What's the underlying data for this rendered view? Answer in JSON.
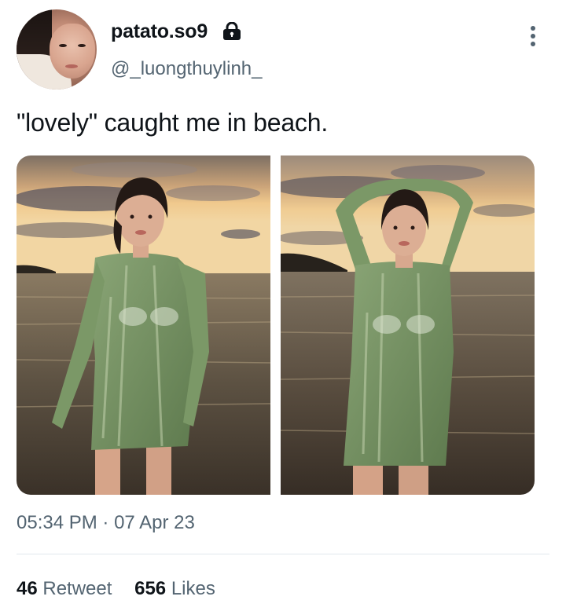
{
  "user": {
    "display_name": "patato.so9",
    "handle": "@_luongthuylinh_",
    "protected": true
  },
  "tweet": {
    "text": "\"lovely\" caught me in beach.",
    "time": "05:34 PM",
    "separator": "·",
    "date": "07 Apr 23"
  },
  "stats": {
    "retweets_count": "46",
    "retweets_label": "Retweet",
    "likes_count": "656",
    "likes_label": "Likes"
  },
  "icons": {
    "protected": "lock-icon",
    "more": "more-vertical-icon"
  },
  "colors": {
    "text_primary": "#0f1419",
    "text_secondary": "#536471",
    "divider": "#e1e8ed",
    "sweater_green": "#7d9a6a"
  }
}
